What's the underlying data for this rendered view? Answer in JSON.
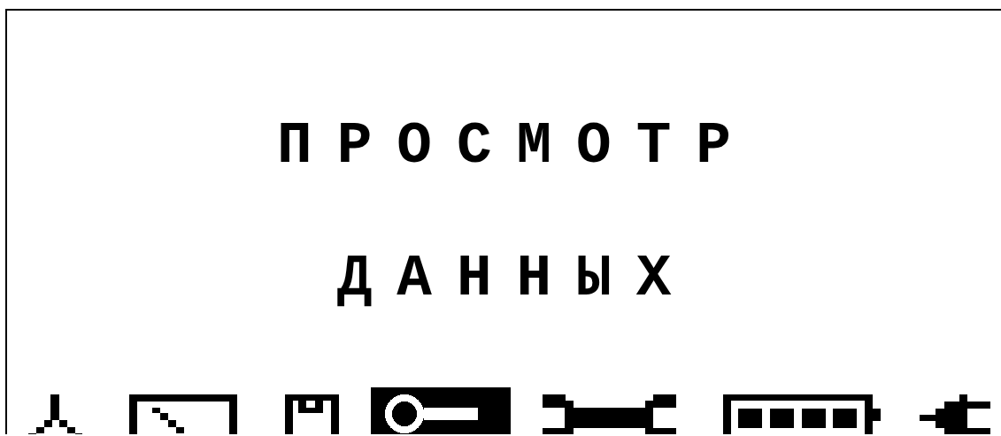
{
  "screen": {
    "title_lines": [
      "ПРОСМОТР",
      "ДАННЫХ"
    ],
    "menu_icons": [
      {
        "kind": "antenna",
        "selected": false
      },
      {
        "kind": "display",
        "selected": false
      },
      {
        "kind": "floppy",
        "selected": false
      },
      {
        "kind": "key",
        "selected": true
      },
      {
        "kind": "wrench",
        "selected": false
      },
      {
        "kind": "battery",
        "selected": false
      },
      {
        "kind": "plug",
        "selected": false
      }
    ]
  }
}
